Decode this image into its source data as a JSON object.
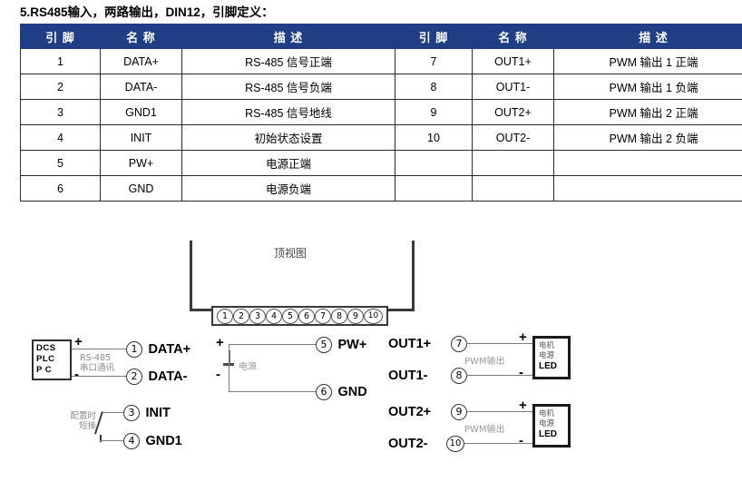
{
  "document": {
    "title": "5.RS485输入，两路输出，DIN12，引脚定义："
  },
  "table": {
    "headers": [
      "引 脚",
      "名 称",
      "描 述",
      "引 脚",
      "名 称",
      "描 述"
    ],
    "rows": [
      {
        "pin_l": "1",
        "name_l": "DATA+",
        "desc_l": "RS-485 信号正端",
        "pin_r": "7",
        "name_r": "OUT1+",
        "desc_r": "PWM 输出 1 正端"
      },
      {
        "pin_l": "2",
        "name_l": "DATA-",
        "desc_l": "RS-485 信号负端",
        "pin_r": "8",
        "name_r": "OUT1-",
        "desc_r": "PWM 输出 1 负端"
      },
      {
        "pin_l": "3",
        "name_l": "GND1",
        "desc_l": "RS-485 信号地线",
        "pin_r": "9",
        "name_r": "OUT2+",
        "desc_r": "PWM 输出 2 正端"
      },
      {
        "pin_l": "4",
        "name_l": "INIT",
        "desc_l": "初始状态设置",
        "pin_r": "10",
        "name_r": "OUT2-",
        "desc_r": "PWM 输出 2 负端"
      },
      {
        "pin_l": "5",
        "name_l": "PW+",
        "desc_l": "电源正端",
        "pin_r": "",
        "name_r": "",
        "desc_r": ""
      },
      {
        "pin_l": "6",
        "name_l": "GND",
        "desc_l": "电源负端",
        "pin_r": "",
        "name_r": "",
        "desc_r": ""
      }
    ]
  },
  "diagram": {
    "top_view_label": "顶视图",
    "connector_pins": [
      "1",
      "2",
      "3",
      "4",
      "5",
      "6",
      "7",
      "8",
      "9",
      "10"
    ],
    "rs485": {
      "device_lines": [
        "DCS",
        "PLC",
        "P  C"
      ],
      "bus_label_line1": "RS-485",
      "bus_label_line2": "串口通讯",
      "plus": "+",
      "minus": "-",
      "pin1_num": "1",
      "pin1_label": "DATA+",
      "pin2_num": "2",
      "pin2_label": "DATA-"
    },
    "init": {
      "note_line1": "配置时",
      "note_line2": "短接",
      "pin3_num": "3",
      "pin3_label": "INIT",
      "pin4_num": "4",
      "pin4_label": "GND1"
    },
    "power": {
      "plus": "+",
      "minus": "-",
      "source_label": "电源",
      "pin5_num": "5",
      "pin5_label": "PW+",
      "pin6_num": "6",
      "pin6_label": "GND"
    },
    "out1": {
      "label_plus": "OUT1+",
      "pin7_num": "7",
      "label_minus": "OUT1-",
      "pin8_num": "8",
      "pwm_label": "PWM输出",
      "term_plus": "+",
      "term_minus": "-",
      "load_cn1": "电机",
      "load_cn2": "电源",
      "load_led": "LED"
    },
    "out2": {
      "label_plus": "OUT2+",
      "pin9_num": "9",
      "label_minus": "OUT2-",
      "pin10_num": "10",
      "pwm_label": "PWM输出",
      "term_plus": "+",
      "term_minus": "-",
      "load_cn1": "电机",
      "load_cn2": "电源",
      "load_led": "LED"
    }
  },
  "colors": {
    "header_bg": "#1F3E86",
    "header_text": "#FFFFFF",
    "border": "#2A2A2A",
    "wire": "#7C7C7C"
  }
}
